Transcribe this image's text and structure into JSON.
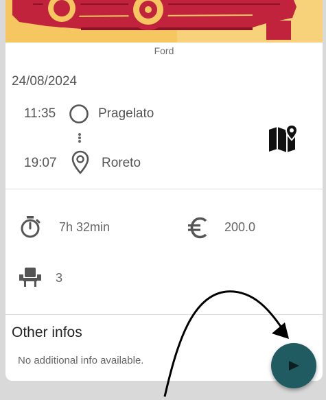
{
  "trip": {
    "brand": "Ford",
    "date": "24/08/2024",
    "departure": {
      "time": "11:35",
      "place": "Pragelato"
    },
    "arrival": {
      "time": "19:07",
      "place": "Roreto"
    }
  },
  "stats": {
    "duration": "7h 32min",
    "price": "200.0",
    "seats": "3"
  },
  "other_infos": {
    "title": "Other infos",
    "text": "No additional info available."
  },
  "icons": {
    "departure": "circle-outline-icon",
    "arrival": "map-pin-icon",
    "map": "map-icon",
    "duration": "timer-icon",
    "price": "euro-icon",
    "seats": "seat-icon",
    "fab": "play-icon"
  },
  "colors": {
    "hero_background": "#f6c760",
    "hero_car": "#c0233b",
    "fab": "#1f5b60",
    "page_background": "#d9d9d9"
  }
}
